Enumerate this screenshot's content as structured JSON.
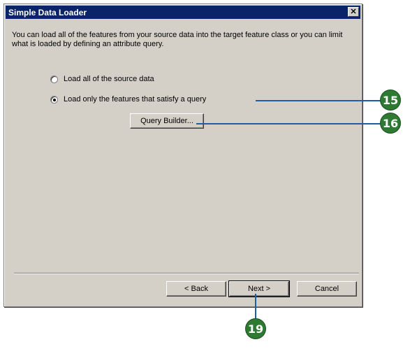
{
  "window": {
    "title": "Simple Data Loader",
    "close_symbol": "✕"
  },
  "main": {
    "description": "You can load all of the features from your source data into the target feature class or you can limit what is loaded by defining an attribute query.",
    "options": [
      {
        "label": "Load all of the source data",
        "checked": false
      },
      {
        "label": "Load only the features that satisfy a query",
        "checked": true
      }
    ],
    "query_builder_label": "Query Builder..."
  },
  "footer": {
    "back_label": "< Back",
    "next_label": "Next >",
    "cancel_label": "Cancel"
  },
  "callouts": {
    "a": "15",
    "b": "16",
    "c": "19"
  },
  "colors": {
    "title_bar": "#0a246a",
    "dialog_face": "#d4d0c8",
    "callout_line": "#1e5ea8",
    "callout_badge": "#2f7a32"
  }
}
